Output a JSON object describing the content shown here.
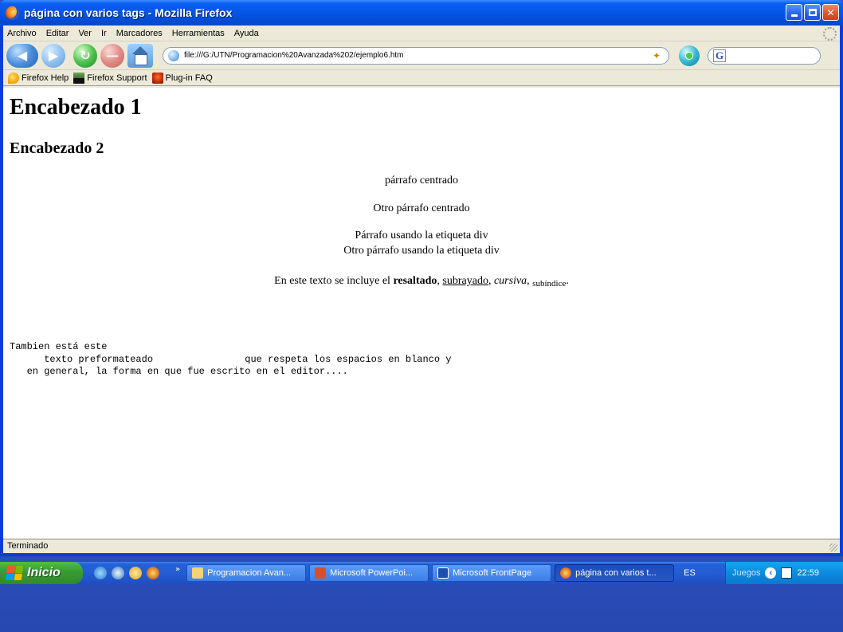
{
  "window": {
    "title": "página con varios tags - Mozilla Firefox"
  },
  "menu": [
    "Archivo",
    "Editar",
    "Ver",
    "Ir",
    "Marcadores",
    "Herramientas",
    "Ayuda"
  ],
  "navigation": {
    "url": "file:///G:/UTN/Programacion%20Avanzada%202/ejemplo6.htm",
    "search_engine": "G"
  },
  "bookmarks": [
    "Firefox Help",
    "Firefox Support",
    "Plug-in FAQ"
  ],
  "page": {
    "h1": "Encabezado 1",
    "h2": "Encabezado 2",
    "p1": "párrafo centrado",
    "p2": "Otro párrafo centrado",
    "div1": "Párrafo usando la etiqueta div",
    "div2": "Otro párrafo usando la etiqueta div",
    "styled": {
      "intro": "En este texto se incluye el ",
      "bold": "resaltado",
      "sep1": ", ",
      "underline": "subrayado",
      "sep2": ", ",
      "italic": "cursiva",
      "sep3": ", ",
      "subscript": "subíndice",
      "end": "."
    },
    "pre": "Tambien está este\n      texto preformateado                que respeta los espacios en blanco y\n   en general, la forma en que fue escrito en el editor...."
  },
  "status": "Terminado",
  "taskbar": {
    "start": "Inicio",
    "tasks": [
      "Programacion Avan...",
      "Microsoft PowerPoi...",
      "Microsoft FrontPage",
      "página con varios t..."
    ],
    "lang": "ES",
    "tray_label": "Juegos",
    "clock": "22:59"
  }
}
